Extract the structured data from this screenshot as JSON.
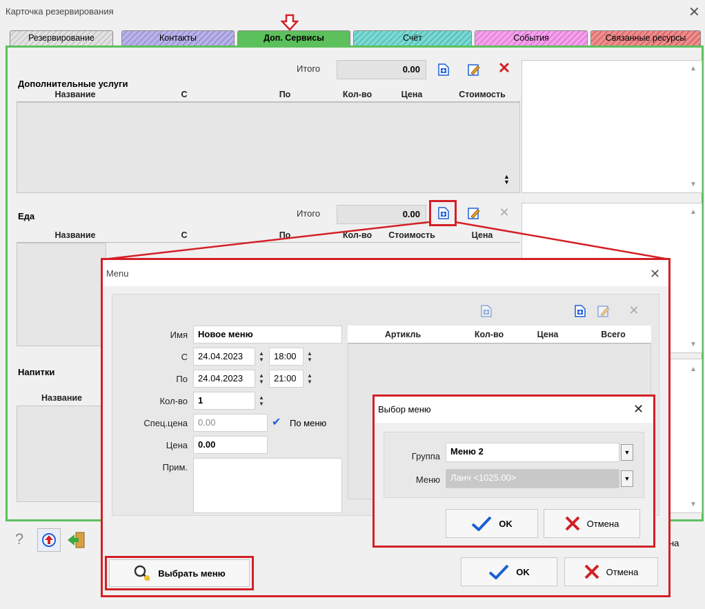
{
  "window": {
    "title": "Карточка резервирования"
  },
  "tabs": [
    {
      "label": "Резервирование"
    },
    {
      "label": "Контакты"
    },
    {
      "label": "Доп. Сервисы"
    },
    {
      "label": "Счёт"
    },
    {
      "label": "События"
    },
    {
      "label": "Связанные ресурсы"
    }
  ],
  "extra_services": {
    "title": "Дополнительные услуги",
    "total_label": "Итого",
    "total_value": "0.00",
    "columns": [
      "Название",
      "С",
      "По",
      "Кол-во",
      "Цена",
      "Стоимость"
    ]
  },
  "food": {
    "title": "Еда",
    "total_label": "Итого",
    "total_value": "0.00",
    "columns": [
      "Название",
      "С",
      "По",
      "Кол-во",
      "Стоимость",
      "Цена"
    ]
  },
  "drinks": {
    "title": "Напитки",
    "columns": [
      "Название"
    ]
  },
  "bottom_partial": "на",
  "menu_dialog": {
    "title": "Menu",
    "name_label": "Имя",
    "name_value": "Новое меню",
    "from_label": "С",
    "from_date": "24.04.2023",
    "from_time": "18:00",
    "to_label": "По",
    "to_date": "24.04.2023",
    "to_time": "21:00",
    "qty_label": "Кол-во",
    "qty_value": "1",
    "spec_price_label": "Спец.цена",
    "spec_price_value": "0.00",
    "by_menu_label": "По меню",
    "price_label": "Цена",
    "price_value": "0.00",
    "note_label": "Прим.",
    "columns": [
      "Артикль",
      "Кол-во",
      "Цена",
      "Всего"
    ],
    "choose_menu_label": "Выбрать меню",
    "ok_label": "OK",
    "cancel_label": "Отмена"
  },
  "menu_select_dialog": {
    "title": "Выбор меню",
    "group_label": "Группа",
    "group_value": "Меню 2",
    "menu_label": "Меню",
    "menu_value": "Ланч <1025.00>",
    "ok_label": "OK",
    "cancel_label": "Отмена"
  },
  "colors": {
    "accent_green": "#5cc05c",
    "highlight_red": "#d41f26",
    "check_blue": "#1a5fd4"
  }
}
